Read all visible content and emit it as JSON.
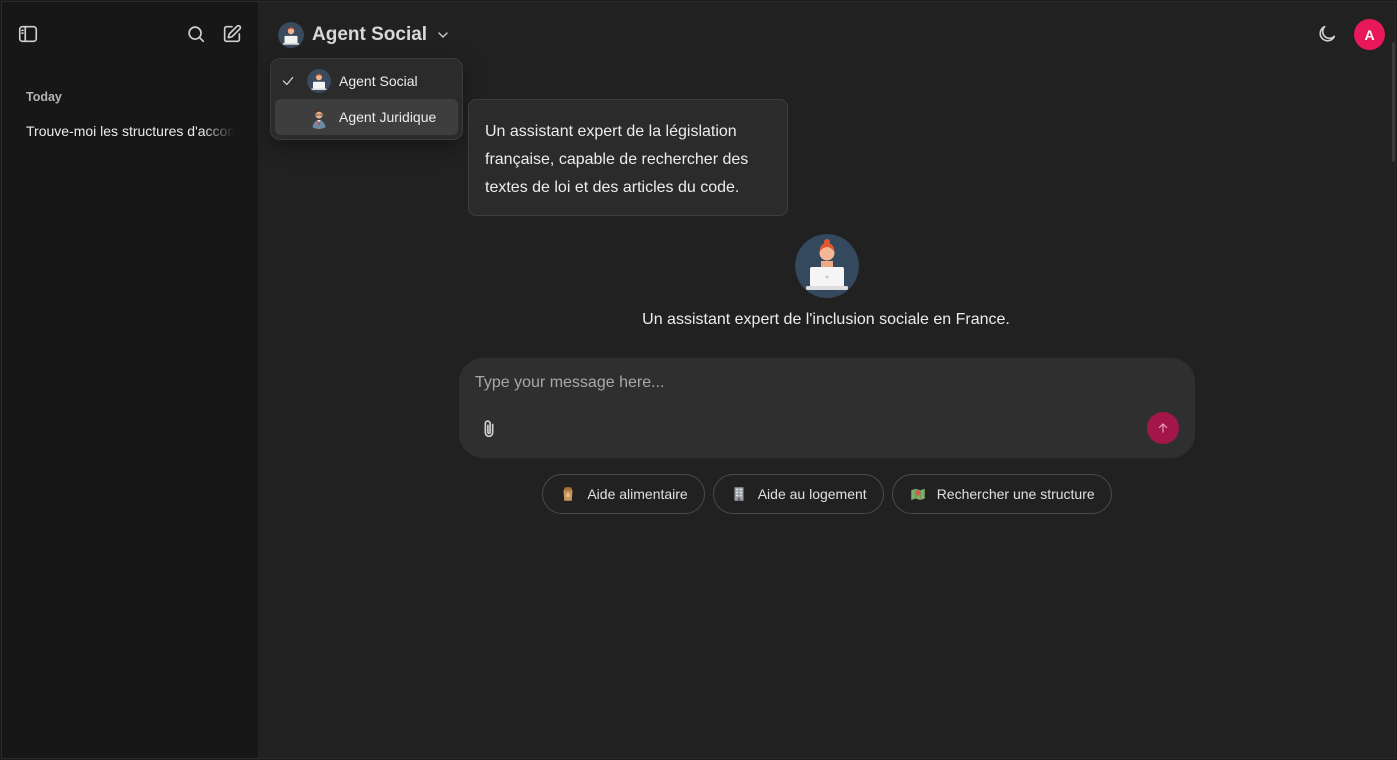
{
  "sidebar": {
    "section_label": "Today",
    "chats": [
      {
        "title": "Trouve-moi les structures d'accompagnement"
      }
    ]
  },
  "header": {
    "model_name": "Agent Social",
    "user_initial": "A"
  },
  "model_dropdown": {
    "items": [
      {
        "label": "Agent Social",
        "selected": true
      },
      {
        "label": "Agent Juridique",
        "selected": false,
        "hovered": true
      }
    ],
    "tooltip": "Un assistant expert de la législation française, capable de rechercher des textes de loi et des articles du code."
  },
  "main": {
    "agent_description": "Un assistant expert de l'inclusion sociale en France.",
    "composer": {
      "placeholder": "Type your message here..."
    },
    "suggestions": [
      {
        "label": "Aide alimentaire",
        "icon": "food-bag-icon"
      },
      {
        "label": "Aide au logement",
        "icon": "building-icon"
      },
      {
        "label": "Rechercher une structure",
        "icon": "map-icon"
      }
    ]
  },
  "colors": {
    "accent": "#e8185a",
    "send_button": "#a3164a",
    "background": "#212121",
    "sidebar": "#171717"
  }
}
